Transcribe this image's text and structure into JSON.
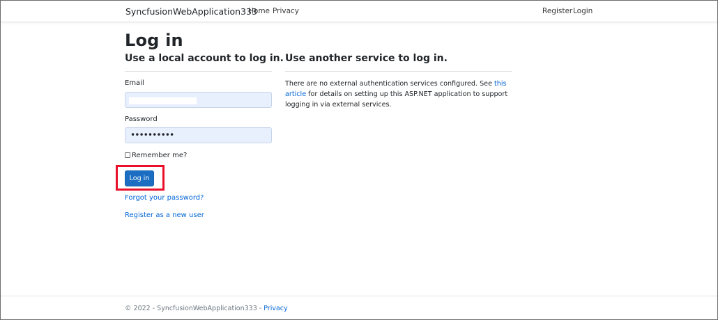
{
  "navbar": {
    "brand": "SyncfusionWebApplication333",
    "left_links": [
      "Home",
      "Privacy"
    ],
    "right_links": [
      "Register",
      "Login"
    ]
  },
  "page": {
    "title": "Log in",
    "local_heading": "Use a local account to log in.",
    "external_heading": "Use another service to log in."
  },
  "form": {
    "email_label": "Email",
    "email_value": "",
    "password_label": "Password",
    "password_value": "••••••••••",
    "remember_label": "Remember me?",
    "remember_checked": false,
    "submit_label": "Log in",
    "forgot_link": "Forgot your password?",
    "register_link": "Register as a new user"
  },
  "external": {
    "text_before": "There are no external authentication services configured. See ",
    "link_text": "this article",
    "text_after": " for details on setting up this ASP.NET application to support logging in via external services."
  },
  "footer": {
    "text": "© 2022 - SyncfusionWebApplication333 - ",
    "privacy_link": "Privacy"
  },
  "colors": {
    "primary_button": "#1b6ec2",
    "link": "#0366d6",
    "highlight_box": "#e8102a",
    "input_autofill_bg": "#e8f0fe"
  },
  "icons": {
    "checkbox": "checkbox-unchecked-icon"
  }
}
